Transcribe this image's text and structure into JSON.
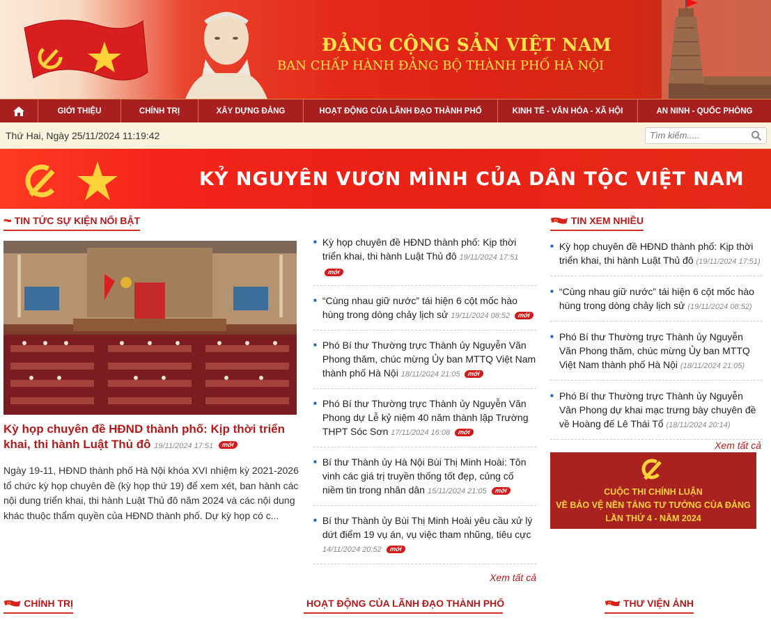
{
  "header": {
    "title_line1": "ĐẢNG CỘNG SẢN VIỆT NAM",
    "title_line2": "BAN CHẤP HÀNH ĐẢNG BỘ THÀNH PHỐ HÀ NỘI"
  },
  "nav": {
    "home_icon": "home-icon",
    "items": [
      "GIỚI THIỆU",
      "CHÍNH TRỊ",
      "XÂY DỰNG ĐẢNG",
      "HOẠT ĐỘNG CỦA LÃNH ĐẠO THÀNH PHỐ",
      "KINH TẾ - VĂN HÓA - XÃ HỘI",
      "AN NINH - QUỐC PHÒNG"
    ]
  },
  "infobar": {
    "date": "Thứ Hai, Ngày 25/11/2024 11:19:42",
    "search_placeholder": "Tìm kiếm....."
  },
  "banner2": {
    "slogan": "KỶ NGUYÊN VƯƠN MÌNH CỦA DÂN TỘC VIỆT NAM"
  },
  "featured": {
    "section_title": "TIN TỨC SỰ KIỆN NỔI BẬT",
    "title": "Kỳ họp chuyên đề HĐND thành phố: Kịp thời triển khai, thi hành Luật Thủ đô",
    "date": "19/11/2024 17:51",
    "badge": "mới",
    "summary": "Ngày 19-11, HĐND thành phố Hà Nội khóa XVI nhiệm kỳ 2021-2026 tổ chức kỳ họp chuyên đề (kỳ họp thứ 19) để xem xét, ban hành các nội dung triển khai, thi hành Luật Thủ đô năm 2024 và các nội dung khác thuộc thẩm quyền của HĐND thành phố. Dự kỳ họp có c..."
  },
  "news_list": [
    {
      "title": "Kỳ họp chuyên đề HĐND thành phố: Kịp thời triển khai, thi hành Luật Thủ đô",
      "date": "19/11/2024 17:51",
      "badge": "mới"
    },
    {
      "title": "“Cùng nhau giữ nước” tái hiện 6 cột mốc hào hùng trong dòng chảy lịch sử",
      "date": "19/11/2024 08:52",
      "badge": "mới"
    },
    {
      "title": "Phó Bí thư Thường trực Thành ủy Nguyễn Văn Phong thăm, chúc mừng Ủy ban MTTQ Việt Nam thành phố Hà Nội",
      "date": "18/11/2024 21:05",
      "badge": "mới"
    },
    {
      "title": "Phó Bí thư Thường trực Thành ủy Nguyễn Văn Phong dự Lễ kỷ niệm 40 năm thành lập Trường THPT Sóc Sơn",
      "date": "17/11/2024 16:08",
      "badge": "mới"
    },
    {
      "title": "Bí thư Thành ủy Hà Nội Bùi Thị Minh Hoài: Tôn vinh các giá trị truyền thống tốt đẹp, củng cố niềm tin trong nhân dân",
      "date": "15/11/2024 21:05",
      "badge": "mới"
    },
    {
      "title": "Bí thư Thành ủy Bùi Thị Minh Hoài yêu cầu xử lý dứt điểm 19 vụ án, vụ việc tham nhũng, tiêu cực",
      "date": "14/11/2024 20:52",
      "badge": "mới"
    }
  ],
  "more_label": "Xem tất cả",
  "popular": {
    "section_title": "TIN XEM NHIỀU",
    "items": [
      {
        "title": "Kỳ họp chuyên đề HĐND thành phố: Kịp thời triển khai, thi hành Luật Thủ đô",
        "date": "(19/11/2024 17:51)"
      },
      {
        "title": "“Cùng nhau giữ nước” tái hiện 6 cột mốc hào hùng trong dòng chảy lịch sử",
        "date": "(19/11/2024 08:52)"
      },
      {
        "title": "Phó Bí thư Thường trực Thành ủy Nguyễn Văn Phong thăm, chúc mừng Ủy ban MTTQ Việt Nam thành phố Hà Nội",
        "date": "(18/11/2024 21:05)"
      },
      {
        "title": "Phó Bí thư Thường trực Thành ủy Nguyễn Văn Phong dự khai mạc trưng bày chuyên đề về Hoàng đế Lê Thái Tổ",
        "date": "(18/11/2024 20:14)"
      }
    ],
    "more_label": "Xem tất cả"
  },
  "contest": {
    "line1": "CUỘC THI CHÍNH LUẬN",
    "line2": "VỀ BẢO VỆ NỀN TẢNG TƯ TƯỞNG CỦA ĐẢNG",
    "line3": "LẦN THỨ 4 - NĂM 2024"
  },
  "bottom_sections": [
    "CHÍNH TRỊ",
    "HOẠT ĐỘNG CỦA LÃNH ĐẠO THÀNH PHỐ",
    "THƯ VIỆN ẢNH"
  ],
  "colors": {
    "primary_red": "#a91e1e",
    "title_red": "#b51a1a",
    "gold": "#ffe44d",
    "link_blue": "#1b64b5"
  }
}
